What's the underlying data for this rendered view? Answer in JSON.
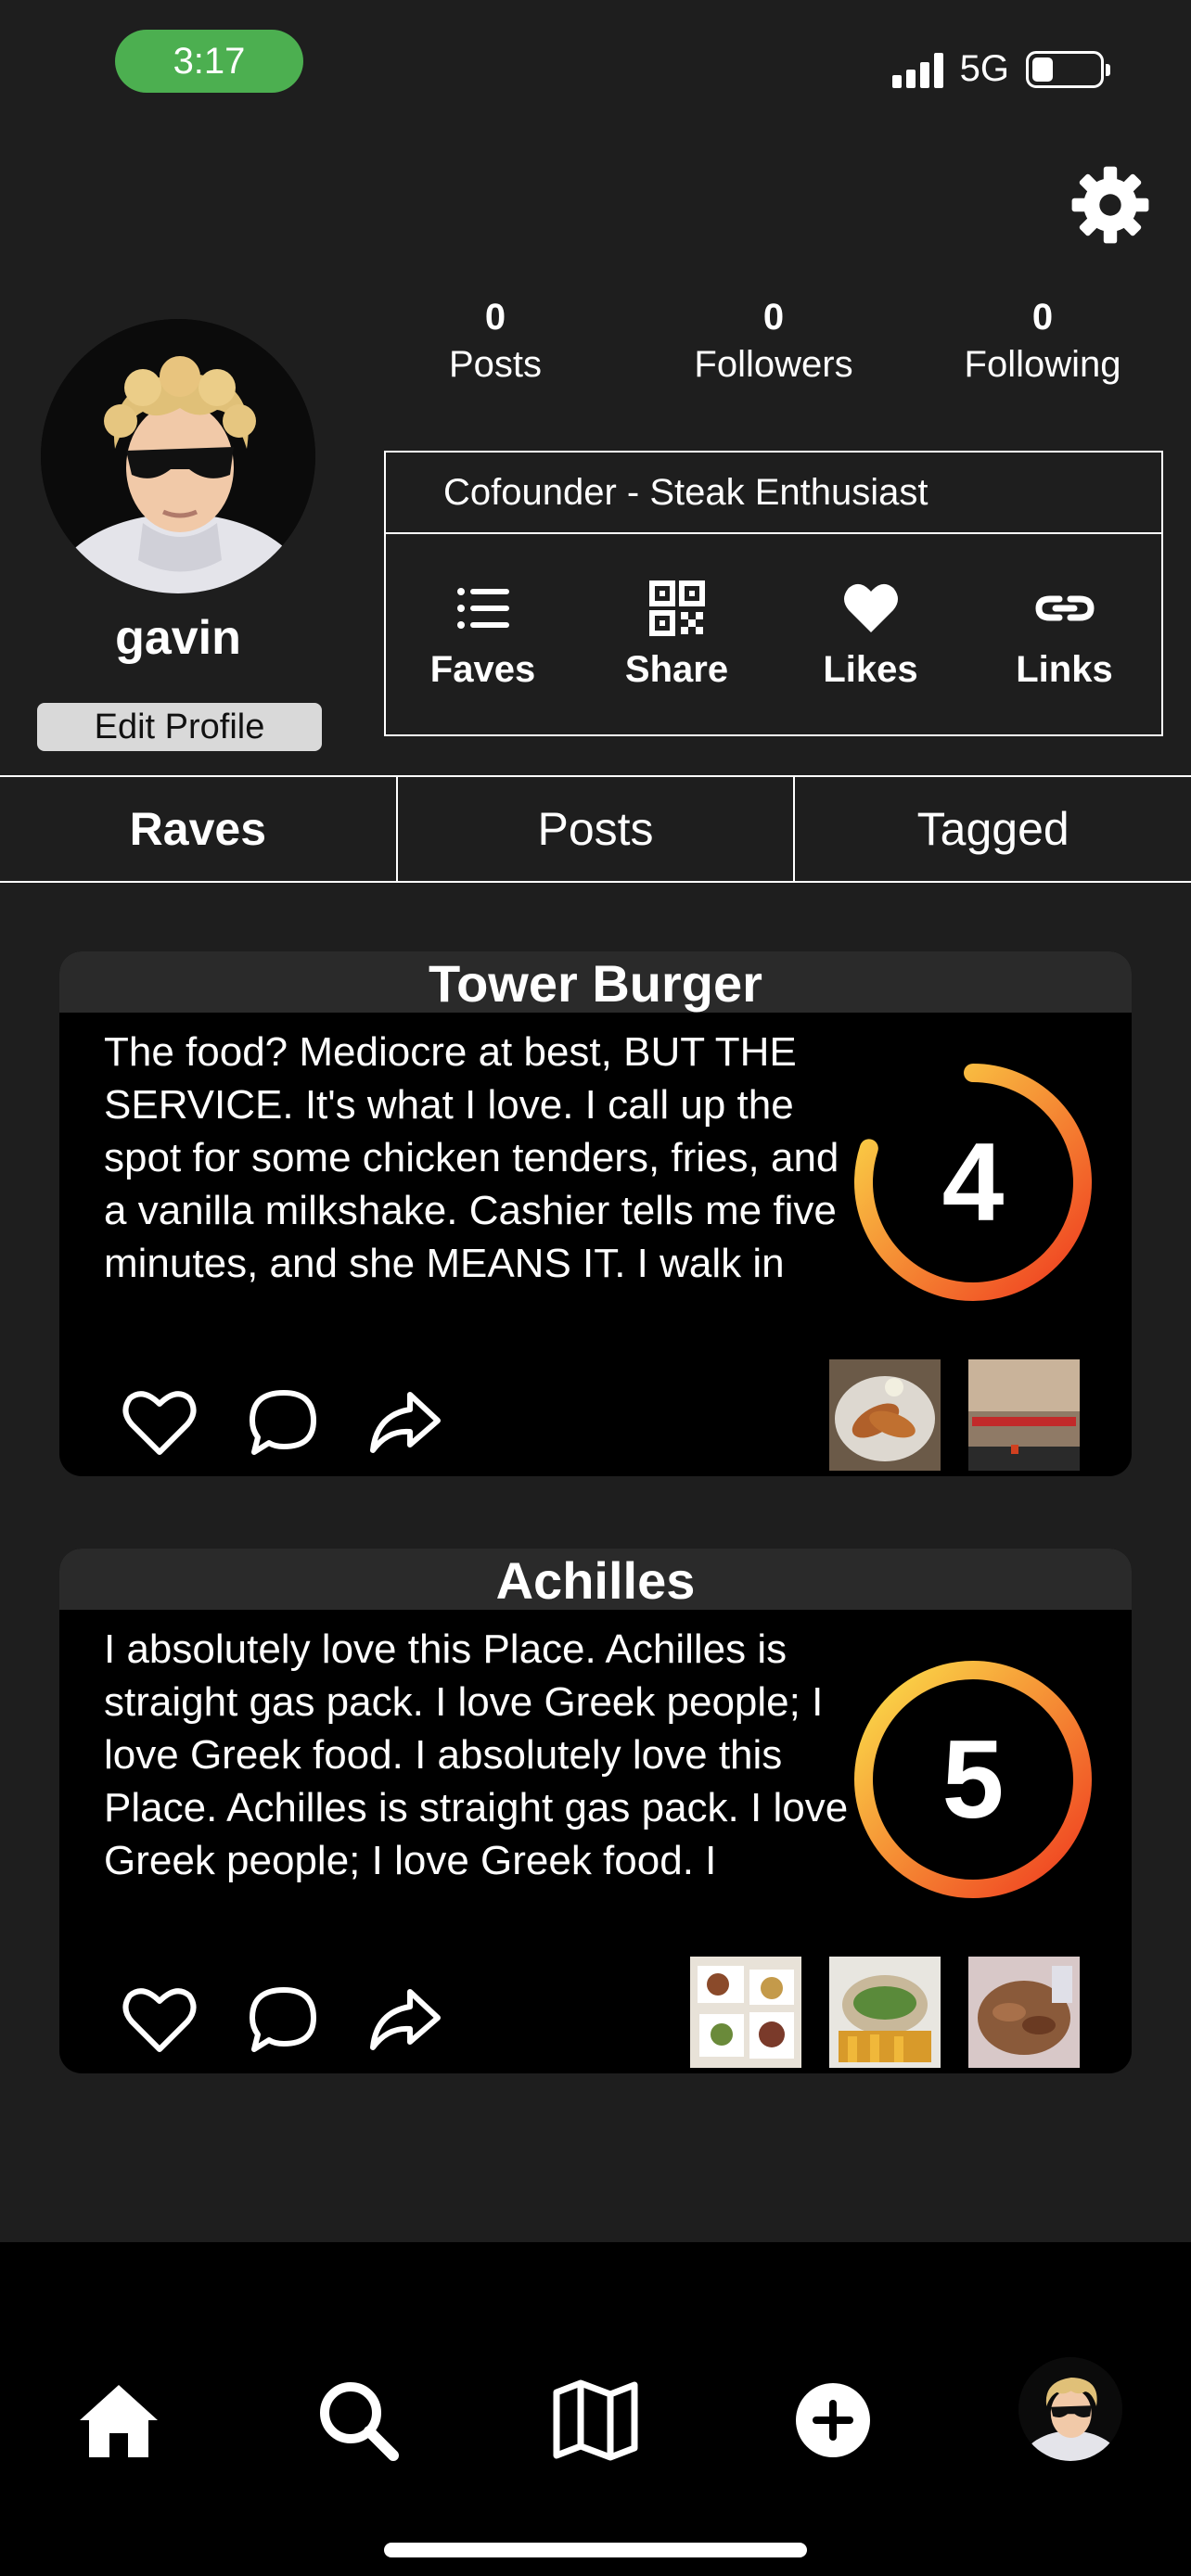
{
  "status_bar": {
    "time": "3:17",
    "network": "5G",
    "battery_fraction": 0.3
  },
  "profile": {
    "username": "gavin",
    "edit_button": "Edit Profile",
    "stats": [
      {
        "value": "0",
        "label": "Posts"
      },
      {
        "value": "0",
        "label": "Followers"
      },
      {
        "value": "0",
        "label": "Following"
      }
    ],
    "bio": "Cofounder - Steak Enthusiast",
    "actions": [
      {
        "label": "Faves",
        "icon": "list-icon"
      },
      {
        "label": "Share",
        "icon": "qr-code-icon"
      },
      {
        "label": "Likes",
        "icon": "heart-icon"
      },
      {
        "label": "Links",
        "icon": "link-icon"
      }
    ]
  },
  "tabs": [
    {
      "label": "Raves",
      "active": true
    },
    {
      "label": "Posts",
      "active": false
    },
    {
      "label": "Tagged",
      "active": false
    }
  ],
  "raves": [
    {
      "title": "Tower Burger",
      "text": "The food? Mediocre at best, BUT THE SERVICE. It's what I love. I call up the spot for some chicken tenders, fries, and a vanilla milkshake. Cashier tells me five minutes, and she MEANS IT. I walk in",
      "rating": "4",
      "rating_fraction": 0.8,
      "photos": [
        "chicken-tenders-photo",
        "storefront-photo"
      ]
    },
    {
      "title": "Achilles",
      "text": "I absolutely love this Place. Achilles is straight gas pack. I love Greek people; I love Greek food. I absolutely love this Place. Achilles is straight gas pack. I love Greek people; I love Greek food. I absolutely",
      "rating": "5",
      "rating_fraction": 1.0,
      "photos": [
        "platters-photo",
        "wrap-fries-photo",
        "gyro-meat-photo"
      ]
    }
  ],
  "bottom_nav": [
    "home-icon",
    "search-icon",
    "map-icon",
    "add-icon",
    "profile-avatar"
  ],
  "colors": {
    "background": "#1e1e1e",
    "status_pill": "#4caf50",
    "ring_start": "#ef3a1f",
    "ring_end": "#fbe04a"
  }
}
